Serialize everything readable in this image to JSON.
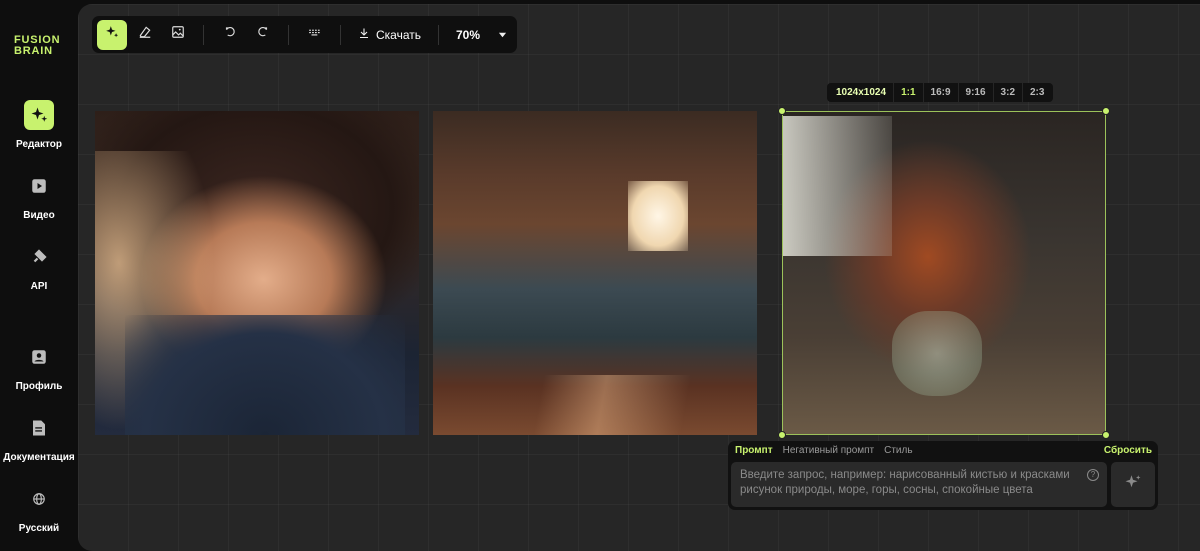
{
  "logo": {
    "line1": "FUSION",
    "line2": "BRAIN"
  },
  "sidebar": {
    "items": [
      {
        "label": "Редактор",
        "icon": "sparkle-icon",
        "active": true
      },
      {
        "label": "Видео",
        "icon": "play-icon",
        "active": false
      },
      {
        "label": "API",
        "icon": "api-icon",
        "active": false
      },
      {
        "label": "Профиль",
        "icon": "profile-icon",
        "active": false
      },
      {
        "label": "Документация",
        "icon": "document-icon",
        "active": false
      },
      {
        "label": "Русский",
        "icon": "globe-icon",
        "active": false
      }
    ]
  },
  "toolbar": {
    "tools": [
      "sparkle-icon",
      "eraser-icon",
      "image-icon",
      "undo-icon",
      "redo-icon",
      "keyboard-icon"
    ],
    "download_label": "Скачать",
    "zoom": "70%"
  },
  "canvas": {
    "images": [
      "anime-girl-portrait",
      "kitchen-interior",
      "flower-vase"
    ]
  },
  "ratio_bar": {
    "size": "1024x1024",
    "ratios": [
      "1:1",
      "16:9",
      "9:16",
      "3:2",
      "2:3"
    ],
    "selected": "1:1"
  },
  "prompt": {
    "tabs": [
      "Промпт",
      "Негативный промпт",
      "Стиль"
    ],
    "active_tab": "Промпт",
    "reset_label": "Сбросить",
    "placeholder_line1": "Введите запрос, например: нарисованный кистью и красками",
    "placeholder_line2": "рисунок природы, море, горы, сосны, спокойные цвета",
    "help": "?"
  },
  "colors": {
    "accent": "#c8f26e",
    "canvas": "#262626",
    "panel": "#0f0f0f"
  }
}
